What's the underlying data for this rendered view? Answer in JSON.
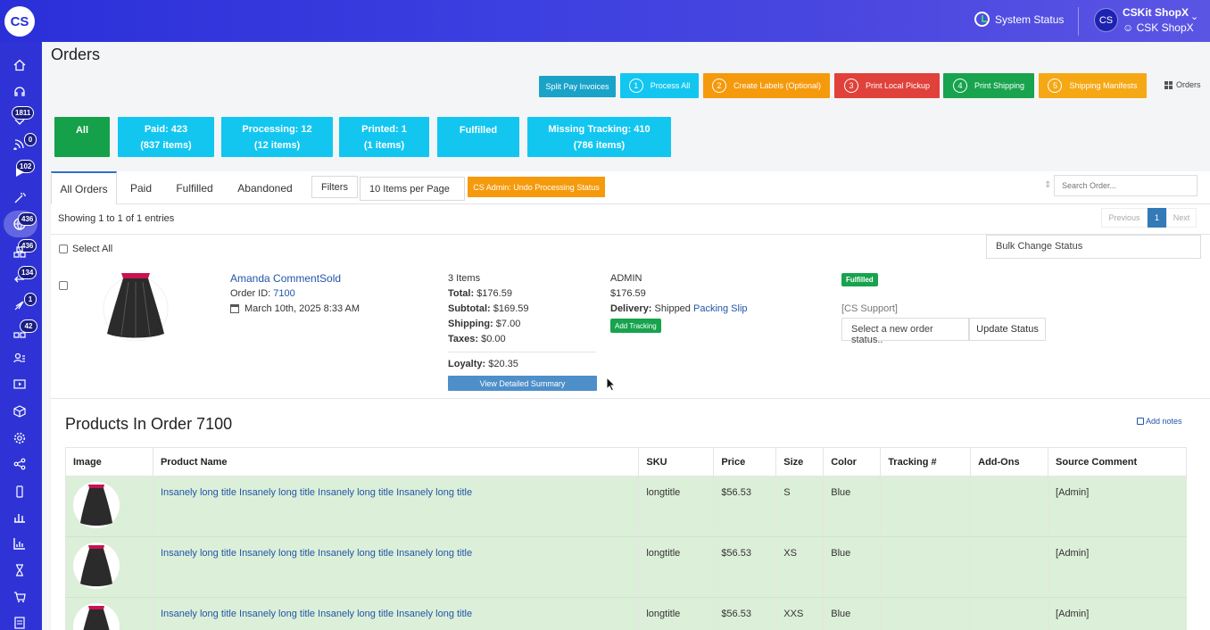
{
  "app": {
    "logo_text": "CS",
    "system_status": "System Status",
    "user_initials": "CS",
    "user_name": "CSKit ShopX",
    "store_name": "CSK ShopX"
  },
  "sidebar": {
    "badges": [
      "1811",
      "0",
      "102",
      "436",
      "436",
      "134",
      "1",
      "42"
    ]
  },
  "page": {
    "title": "Orders",
    "orders_link": "Orders"
  },
  "actions": [
    {
      "label": "Split Pay Invoices",
      "num": "",
      "color": "#1aa3c9"
    },
    {
      "label": "Process All",
      "num": "1",
      "color": "#12c6f0"
    },
    {
      "label": "Create Labels (Optional)",
      "num": "2",
      "color": "#f59a0c"
    },
    {
      "label": "Print Local Pickup",
      "num": "3",
      "color": "#e0413a"
    },
    {
      "label": "Print Shipping",
      "num": "4",
      "color": "#18a34e"
    },
    {
      "label": "Shipping Manifests",
      "num": "5",
      "color": "#f5a814"
    }
  ],
  "filters": [
    {
      "line1": "All",
      "line2": ""
    },
    {
      "line1": "Paid: 423",
      "line2": "(837 items)"
    },
    {
      "line1": "Processing: 12",
      "line2": "(12 items)"
    },
    {
      "line1": "Printed: 1",
      "line2": "(1 items)"
    },
    {
      "line1": "Fulfilled",
      "line2": ""
    },
    {
      "line1": "Missing Tracking: 410",
      "line2": "(786 items)"
    }
  ],
  "tabs": [
    "All Orders",
    "Paid",
    "Fulfilled",
    "Abandoned"
  ],
  "toolbar": {
    "filters": "Filters",
    "per_page": "10 Items per Page",
    "undo": "CS Admin: Undo Processing Status",
    "search_placeholder": "Search Order..."
  },
  "listing": {
    "showing": "Showing 1 to 1 of 1 entries",
    "prev": "Previous",
    "page": "1",
    "next": "Next",
    "select_all": "Select All",
    "bulk_change": "Bulk Change Status"
  },
  "order": {
    "customer": "Amanda CommentSold",
    "order_id_label": "Order ID:",
    "order_id": "7100",
    "date": "March 10th, 2025 8:33 AM",
    "items": "3 Items",
    "total_label": "Total:",
    "total": "$176.59",
    "subtotal_label": "Subtotal:",
    "subtotal": "$169.59",
    "shipping_label": "Shipping:",
    "shipping": "$7.00",
    "taxes_label": "Taxes:",
    "taxes": "$0.00",
    "loyalty_label": "Loyalty:",
    "loyalty": "$20.35",
    "detail_btn": "View Detailed Summary",
    "admin": "ADMIN",
    "admin_amount": "$176.59",
    "delivery_label": "Delivery:",
    "delivery_status": "Shipped",
    "packing_slip": "Packing Slip",
    "add_tracking": "Add Tracking",
    "status_badge": "Fulfilled",
    "support": "[CS Support]",
    "status_select": "Select a new order status..",
    "update_status": "Update Status"
  },
  "products": {
    "title": "Products In Order 7100",
    "add_notes": "Add notes",
    "headers": [
      "Image",
      "Product Name",
      "SKU",
      "Price",
      "Size",
      "Color",
      "Tracking #",
      "Add-Ons",
      "Source Comment"
    ],
    "rows": [
      {
        "name": "Insanely long title Insanely long title Insanely long title Insanely long title",
        "sku": "longtitle",
        "price": "$56.53",
        "size": "S",
        "color": "Blue",
        "tracking": "",
        "addons": "",
        "source": "[Admin]"
      },
      {
        "name": "Insanely long title Insanely long title Insanely long title Insanely long title",
        "sku": "longtitle",
        "price": "$56.53",
        "size": "XS",
        "color": "Blue",
        "tracking": "",
        "addons": "",
        "source": "[Admin]"
      },
      {
        "name": "Insanely long title Insanely long title Insanely long title Insanely long title",
        "sku": "longtitle",
        "price": "$56.53",
        "size": "XXS",
        "color": "Blue",
        "tracking": "",
        "addons": "",
        "source": "[Admin]"
      }
    ]
  }
}
